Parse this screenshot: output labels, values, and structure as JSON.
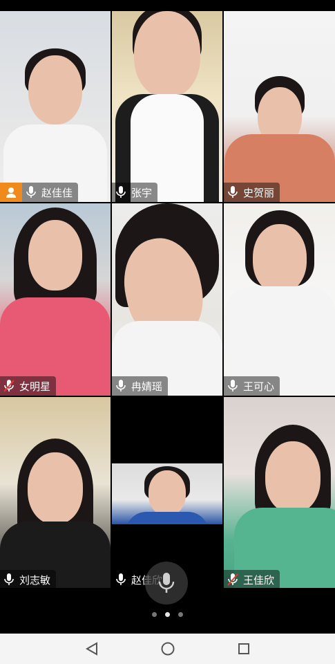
{
  "participants": [
    {
      "name": "赵佳佳",
      "host": true,
      "active": false
    },
    {
      "name": "张宇",
      "host": false,
      "active": true
    },
    {
      "name": "史贺丽",
      "host": false,
      "active": false
    },
    {
      "name": "女明星",
      "host": false,
      "active": false,
      "muted": true
    },
    {
      "name": "冉婧瑶",
      "host": false,
      "active": false
    },
    {
      "name": "王可心",
      "host": false,
      "active": false
    },
    {
      "name": "刘志敏",
      "host": false,
      "active": false
    },
    {
      "name": "赵佳欣",
      "host": false,
      "active": false
    },
    {
      "name": "王佳欣",
      "host": false,
      "active": false,
      "muted": true
    }
  ],
  "pager": {
    "count": 3,
    "active_index": 1
  },
  "icons": {
    "mic": "microphone-icon",
    "mic_muted": "microphone-muted-icon",
    "host": "host-person-icon",
    "back": "back-triangle-icon",
    "home": "home-circle-icon",
    "recents": "recents-square-icon"
  },
  "colors": {
    "active_border": "#36b14a",
    "host_badge": "#f08a1d"
  }
}
